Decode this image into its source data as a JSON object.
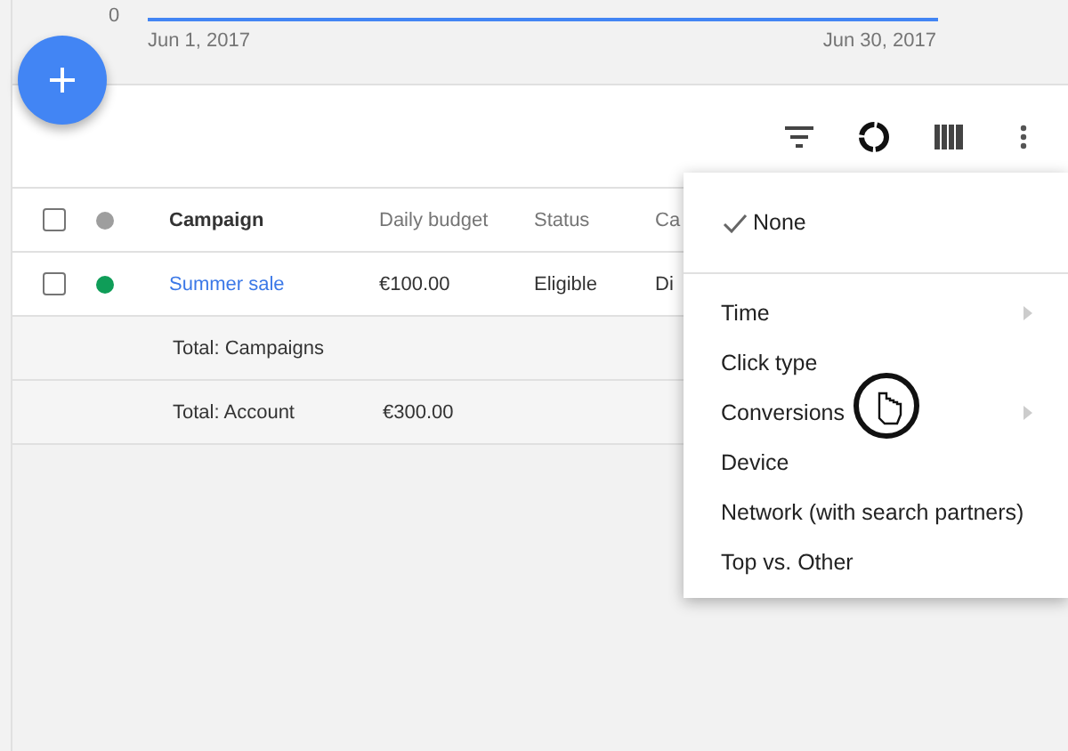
{
  "chart": {
    "y_tick": "0",
    "x_labels": [
      "Jun 1, 2017",
      "Jun 30, 2017"
    ]
  },
  "table": {
    "header": {
      "checked": false,
      "color": "#9e9e9e",
      "cells": [
        "Campaign",
        "Daily budget",
        "Status",
        "Ca"
      ]
    },
    "rows": [
      {
        "checked": false,
        "color": "#0f9d58",
        "cells": [
          "Summer sale",
          "€100.00",
          "Eligible",
          "Di"
        ]
      }
    ],
    "totals": [
      {
        "label": "Total: Campaigns"
      },
      {
        "label": "Total: Account",
        "budget": "€300.00"
      }
    ]
  },
  "menu": {
    "items": [
      {
        "label": "None",
        "selected": true,
        "submenu": false
      },
      {
        "label": "Time",
        "selected": false,
        "submenu": true
      },
      {
        "label": "Click type",
        "selected": false,
        "submenu": false
      },
      {
        "label": "Conversions",
        "selected": false,
        "submenu": true
      },
      {
        "label": "Device",
        "selected": false,
        "submenu": false
      },
      {
        "label": "Network (with search partners)",
        "selected": false,
        "submenu": false
      },
      {
        "label": "Top vs. Other",
        "selected": false,
        "submenu": false
      }
    ]
  }
}
